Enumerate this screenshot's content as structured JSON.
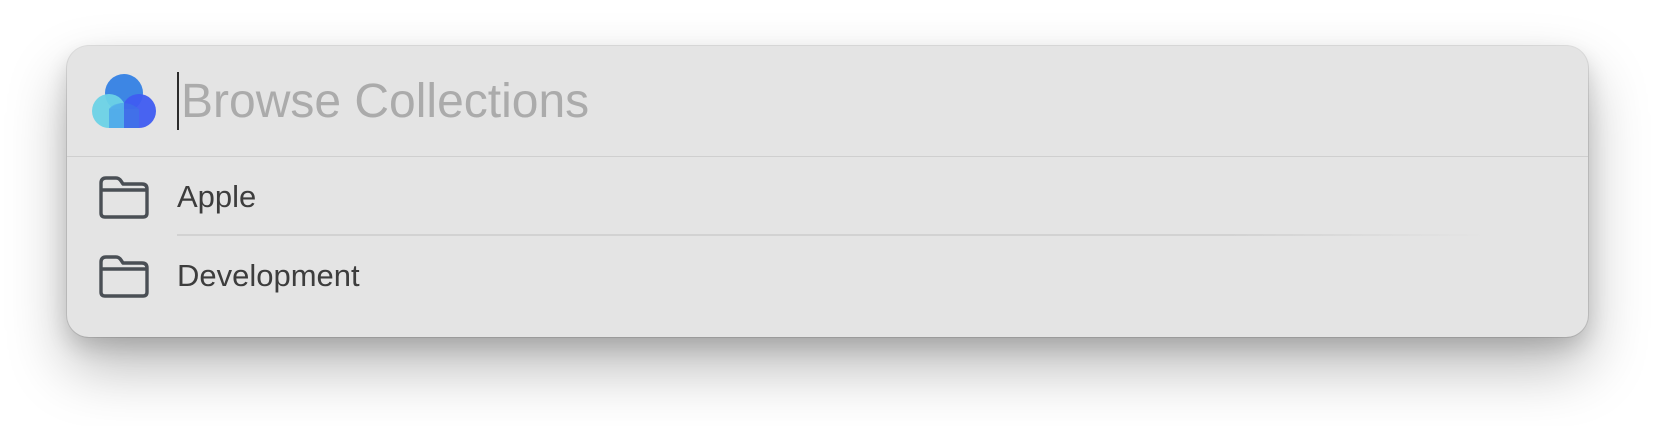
{
  "search": {
    "placeholder": "Browse Collections",
    "value": ""
  },
  "app": {
    "logo_icon": "cloud-logo-icon",
    "logo_colors": [
      "#6ed3e6",
      "#3b82e6",
      "#3b5cf0"
    ]
  },
  "collections": {
    "items": [
      {
        "label": "Apple",
        "icon": "folder-icon"
      },
      {
        "label": "Development",
        "icon": "folder-icon"
      }
    ]
  },
  "colors": {
    "panel_background": "#e4e4e4",
    "placeholder_text": "#ababab",
    "item_text": "#3d3d3d",
    "icon_stroke": "#4a4f55"
  }
}
